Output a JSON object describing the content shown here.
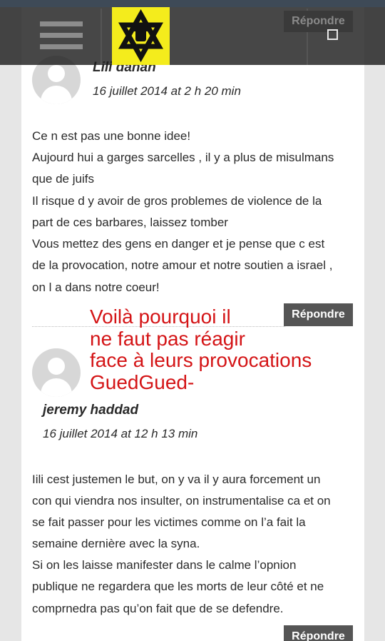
{
  "header": {
    "reply_label": "Répondre"
  },
  "comments": [
    {
      "author": "Lili dahan",
      "date": "16 juillet 2014 at 2 h 20 min",
      "lines": [
        "Ce n est pas une bonne idee!",
        "Aujourd hui a garges sarcelles , il y a plus de misulmans",
        "que de juifs",
        "Il risque d y avoir de gros problemes de violence de la",
        "part de ces barbares, laissez tomber",
        "Vous mettez des gens en danger et je pense que c est",
        "de la provocation, notre amour et notre soutien a israel ,",
        "on l a dans notre coeur!"
      ],
      "reply_label": "Répondre"
    },
    {
      "author": "jeremy haddad",
      "date": "16 juillet 2014 at 12 h 13 min",
      "lines": [
        "Iili cest justemen le but, on y va il y aura forcement un",
        "con qui viendra nos insulter, on instrumentalise ca et on",
        "se fait passer pour les victimes comme on l’a fait la",
        "semaine dernière avec la syna.",
        "Si on les laisse manifester dans le calme l’opnion",
        "publique ne regardera que les morts de leur côté et ne",
        "comprnedra pas qu’on fait que de se defendre."
      ],
      "reply_label": "Répondre"
    }
  ],
  "annotation": {
    "lines": [
      "Voilà pourquoi il",
      "ne faut pas réagir",
      "face à leurs provocations",
      "GuedGued-"
    ],
    "color": "#d41416"
  },
  "colors": {
    "logo_bg": "#f4ec1c",
    "topbar_bg": "#1e1e1e",
    "reply_button_bg": "#555555"
  }
}
